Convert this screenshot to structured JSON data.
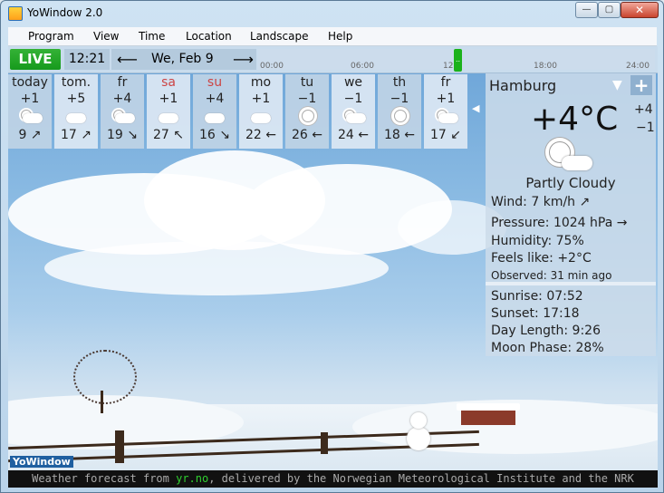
{
  "window": {
    "title": "YoWindow 2.0",
    "min": "—",
    "max": "▢",
    "close": "✕"
  },
  "menu": [
    "Program",
    "View",
    "Time",
    "Location",
    "Landscape",
    "Help"
  ],
  "timebar": {
    "live": "LIVE",
    "time": "12:21",
    "prev": "⟵",
    "date": "We, Feb 9",
    "next": "⟶",
    "ticks": [
      "00:00",
      "06:00",
      "12",
      "18:00",
      "24:00"
    ],
    "marker": ".."
  },
  "forecast": [
    {
      "name": "today",
      "temp": "+1",
      "wind": "9 ↗",
      "icon": "partly-cloudy-icon",
      "weekend": false
    },
    {
      "name": "tom.",
      "temp": "+5",
      "wind": "17 ↗",
      "icon": "cloud-icon",
      "weekend": false
    },
    {
      "name": "fr",
      "temp": "+4",
      "wind": "19 ↘",
      "icon": "partly-cloudy-icon",
      "weekend": false
    },
    {
      "name": "sa",
      "temp": "+1",
      "wind": "27 ↖",
      "icon": "cloud-icon",
      "weekend": true
    },
    {
      "name": "su",
      "temp": "+4",
      "wind": "16 ↘",
      "icon": "cloud-icon",
      "weekend": true
    },
    {
      "name": "mo",
      "temp": "+1",
      "wind": "22 ←",
      "icon": "cloud-icon",
      "weekend": false
    },
    {
      "name": "tu",
      "temp": "−1",
      "wind": "26 ←",
      "icon": "sun-icon",
      "weekend": false
    },
    {
      "name": "we",
      "temp": "−1",
      "wind": "24 ←",
      "icon": "partly-cloudy-icon",
      "weekend": false
    },
    {
      "name": "th",
      "temp": "−1",
      "wind": "18 ←",
      "icon": "sun-icon",
      "weekend": false
    },
    {
      "name": "fr",
      "temp": "+1",
      "wind": "17 ↙",
      "icon": "partly-cloudy-icon",
      "weekend": false
    }
  ],
  "panel": {
    "city": "Hamburg",
    "dropdown": "▼",
    "add": "+",
    "temp": "+4°C",
    "hi": "+4",
    "lo": "−1",
    "condition": "Partly Cloudy",
    "wind": "Wind:  7 km/h  ↗",
    "pressure": "Pressure:  1024 hPa  →",
    "humidity": "Humidity:  75%",
    "feels": "Feels like:  +2°C",
    "observed": "Observed:  31 min ago",
    "sunrise": "Sunrise:  07:52",
    "sunset": "Sunset:  17:18",
    "daylength": "Day Length:  9:26",
    "moon": "Moon Phase:  28%"
  },
  "footer": {
    "pre": "Weather forecast from ",
    "link": "yr.no",
    "post": ", delivered by the Norwegian Meteorological Institute and the NRK"
  },
  "logo": "YoWindow"
}
